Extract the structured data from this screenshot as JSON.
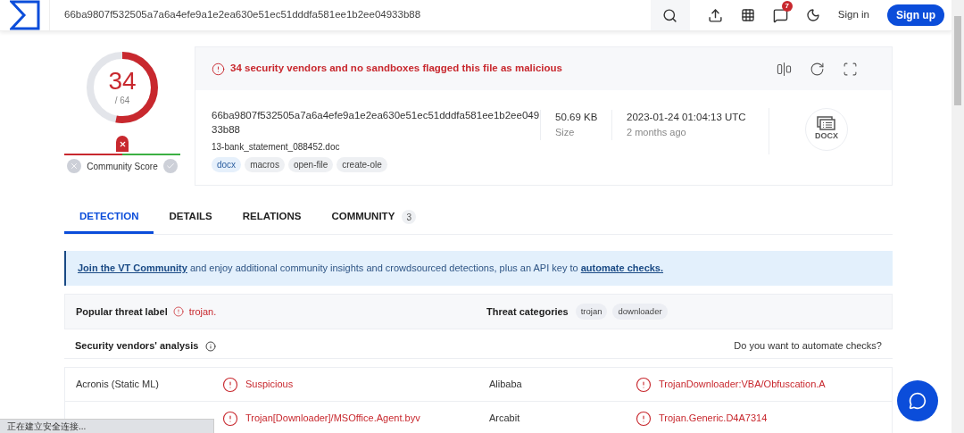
{
  "search": {
    "value": "66ba9807f532505a7a6a4efe9a1e2ea630e51ec51dddfa581ee1b2ee04933b88"
  },
  "nav": {
    "notifications": "7",
    "sign_in": "Sign in",
    "sign_up": "Sign up"
  },
  "score": {
    "detections": "34",
    "total": "/ 64",
    "level": 0.53
  },
  "community_score": {
    "label": "Community Score",
    "level": 0.5
  },
  "alert": "34 security vendors and no sandboxes flagged this file as malicious",
  "file": {
    "hash_lines": [
      "66ba9807f532505a7a6a4efe9a1e2ea630e51ec51dddfa581ee1b2ee049",
      "33b88"
    ],
    "name": "13-bank_statement_088452.doc",
    "tags": [
      {
        "label": "docx",
        "kind": "type"
      },
      {
        "label": "macros",
        "kind": "plain"
      },
      {
        "label": "open-file",
        "kind": "plain"
      },
      {
        "label": "create-ole",
        "kind": "plain"
      }
    ],
    "size": "50.69 KB",
    "size_label": "Size",
    "date": "2023-01-24 01:04:13 UTC",
    "date_ago": "2 months ago",
    "type_badge": "DOCX"
  },
  "tabs": [
    {
      "label": "DETECTION",
      "selected": true
    },
    {
      "label": "DETAILS",
      "selected": false
    },
    {
      "label": "RELATIONS",
      "selected": false
    },
    {
      "label": "COMMUNITY",
      "selected": false,
      "count": "3"
    }
  ],
  "banner": {
    "link": "Join the VT Community",
    "text": " and enjoy additional community insights and crowdsourced detections, plus an API key to ",
    "link2": "automate checks."
  },
  "threat": {
    "label": "Popular threat label",
    "value": "trojan.",
    "categories_label": "Threat categories",
    "categories": [
      "trojan",
      "downloader"
    ]
  },
  "vendors": {
    "title": "Security vendors' analysis",
    "automate": "Do you want to automate checks?",
    "rows": [
      {
        "left": {
          "vendor": "Acronis (Static ML)",
          "result": "Suspicious"
        },
        "right": {
          "vendor": "Alibaba",
          "result": "TrojanDownloader:VBA/Obfuscation.A"
        }
      },
      {
        "left": {
          "result": "Trojan[Downloader]/MSOffice.Agent.byv"
        },
        "right": {
          "vendor": "Arcabit",
          "result": "Trojan.Generic.D4A7314"
        }
      }
    ]
  },
  "status_bar": "正在建立安全连接..."
}
